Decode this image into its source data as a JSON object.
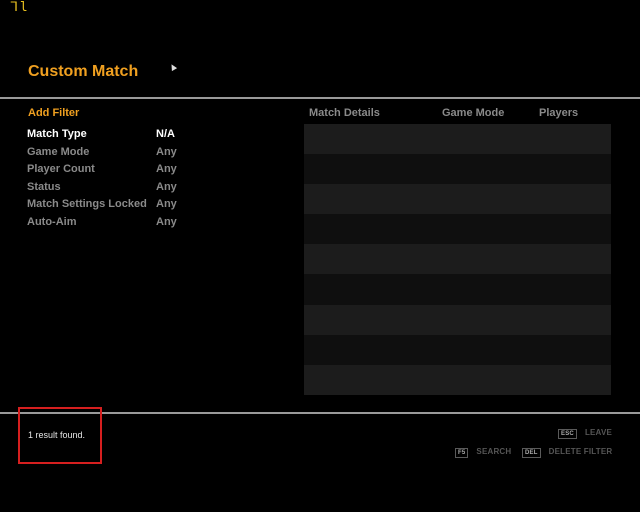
{
  "hud": {
    "fps_indicator": "ᒣl"
  },
  "header": {
    "title": "Custom Match"
  },
  "filters": {
    "heading": "Add Filter",
    "items": [
      {
        "label": "Match Type",
        "value": "N/A",
        "active": true
      },
      {
        "label": "Game Mode",
        "value": "Any",
        "active": false
      },
      {
        "label": "Player Count",
        "value": "Any",
        "active": false
      },
      {
        "label": "Status",
        "value": "Any",
        "active": false
      },
      {
        "label": "Match Settings Locked",
        "value": "Any",
        "active": false
      },
      {
        "label": "Auto-Aim",
        "value": "Any",
        "active": false
      }
    ]
  },
  "results_table": {
    "columns": [
      "Match Details",
      "Game Mode",
      "Players"
    ],
    "row_count_visible": 9
  },
  "status": {
    "text": "1 result found."
  },
  "hints": {
    "leave": {
      "key": "ESC",
      "label": "LEAVE"
    },
    "search": {
      "key": "F5",
      "label": "SEARCH"
    },
    "delete": {
      "key": "DEL",
      "label": "DELETE FILTER"
    }
  },
  "colors": {
    "accent": "#f0a020",
    "highlight": "#d61f1f",
    "background": "#000000"
  }
}
